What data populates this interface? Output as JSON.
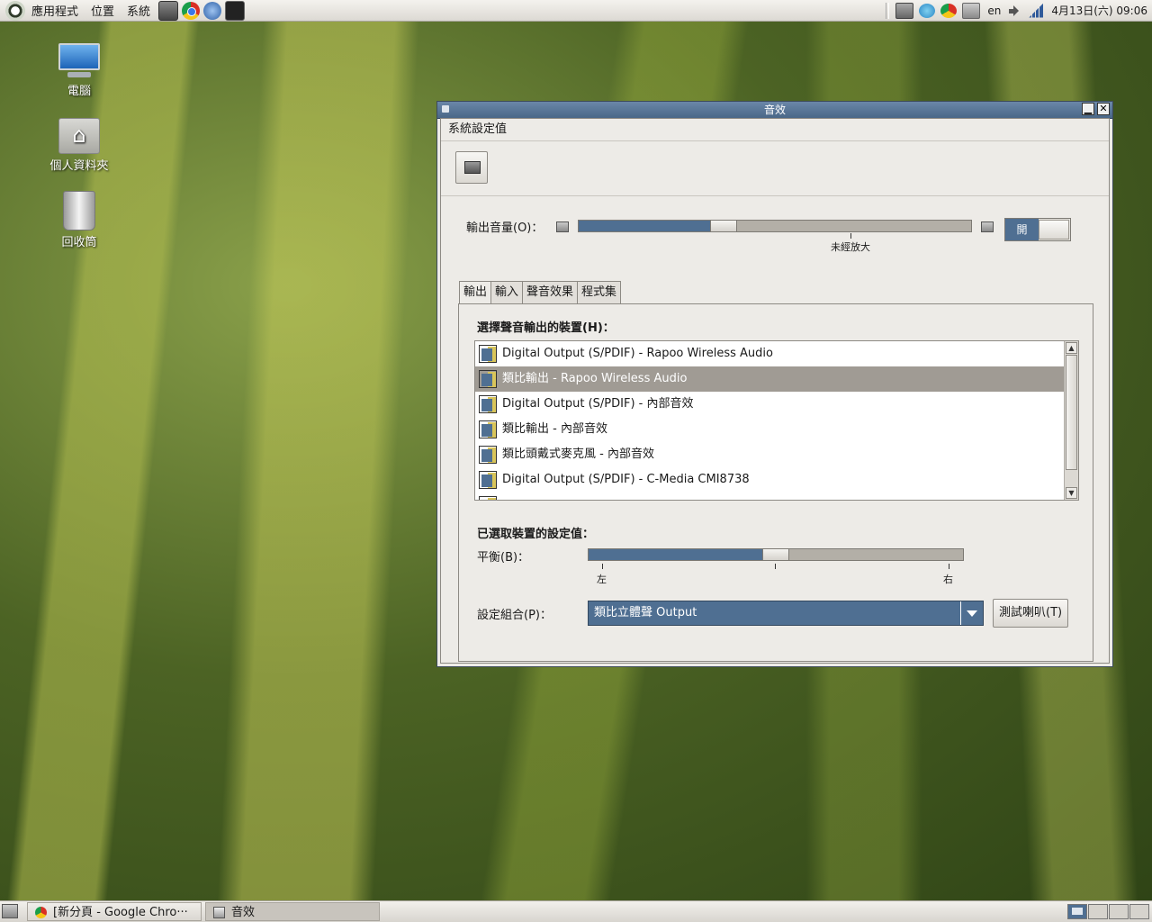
{
  "top_panel": {
    "menus": [
      "應用程式",
      "位置",
      "系統"
    ],
    "keyboard_layout": "en",
    "clock": "4月13日(六) 09:06"
  },
  "desktop_icons": [
    {
      "label": "電腦",
      "icon": "computer-icon"
    },
    {
      "label": "個人資料夾",
      "icon": "home-folder-icon"
    },
    {
      "label": "回收筒",
      "icon": "trash-icon"
    }
  ],
  "window": {
    "title": "音效",
    "menu": "系統設定值",
    "output_volume_label": "輸出音量(O)：",
    "output_volume_level": 0.36,
    "unamplified_label": "未經放大",
    "mute_toggle_label": "開",
    "tabs": [
      "輸出",
      "輸入",
      "聲音效果",
      "程式集"
    ],
    "active_tab": 0,
    "device_section_title": "選擇聲音輸出的裝置(H)：",
    "devices": [
      "Digital Output (S/PDIF) - Rapoo Wireless Audio",
      "類比輸出 - Rapoo Wireless Audio",
      "Digital Output (S/PDIF) - 內部音效",
      "類比輸出 - 內部音效",
      "類比頭戴式麥克風 - 內部音效",
      "Digital Output (S/PDIF) - C-Media CMI8738"
    ],
    "selected_device": 1,
    "settings_section_title": "已選取裝置的設定值：",
    "balance_label": "平衡(B)：",
    "balance_level": 0.5,
    "balance_left": "左",
    "balance_right": "右",
    "profile_label": "設定組合(P)：",
    "profile_value": "類比立體聲 Output",
    "test_button": "測試喇叭(T)"
  },
  "taskbar": {
    "tasks": [
      "[新分頁 - Google Chro···",
      "音效"
    ]
  },
  "colors": {
    "accent": "#4f6f92",
    "selection": "#a09b94",
    "window_bg": "#edebe7"
  }
}
